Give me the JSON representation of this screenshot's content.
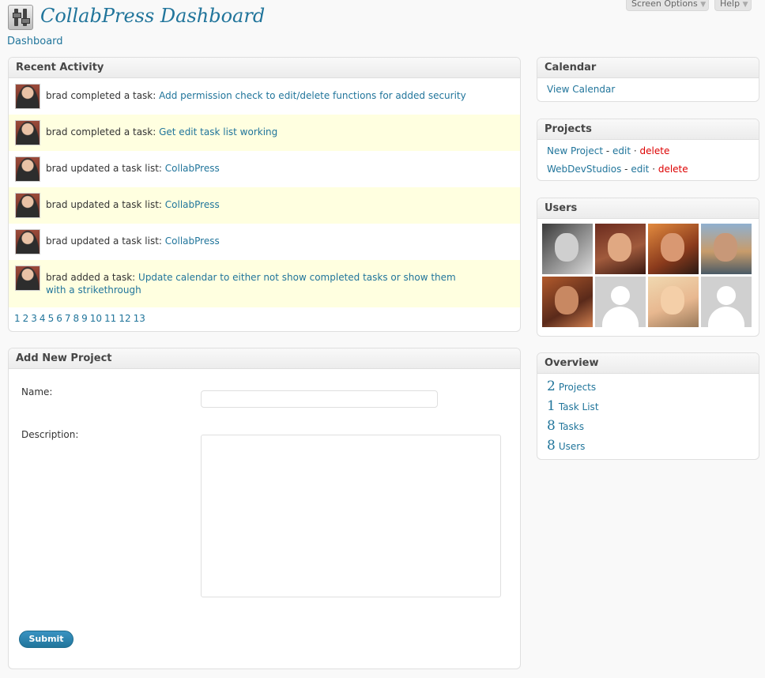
{
  "header": {
    "title": "CollabPress Dashboard",
    "breadcrumb": "Dashboard",
    "screen_options": "Screen Options",
    "help": "Help",
    "dropdown_glyph": "▼"
  },
  "recent_activity": {
    "title": "Recent Activity",
    "items": [
      {
        "text": "brad completed a task: ",
        "link": "Add permission check to edit/delete functions for added security"
      },
      {
        "text": "brad completed a task: ",
        "link": "Get edit task list working"
      },
      {
        "text": "brad updated a task list: ",
        "link": "CollabPress"
      },
      {
        "text": "brad updated a task list: ",
        "link": "CollabPress"
      },
      {
        "text": "brad updated a task list: ",
        "link": "CollabPress"
      },
      {
        "text": "brad added a task: ",
        "link": "Update calendar to either not show completed tasks or show them with a strikethrough"
      }
    ],
    "pages": [
      "1",
      "2",
      "3",
      "4",
      "5",
      "6",
      "7",
      "8",
      "9",
      "10",
      "11",
      "12",
      "13"
    ]
  },
  "add_project": {
    "title": "Add New Project",
    "name_label": "Name:",
    "name_value": "",
    "description_label": "Description:",
    "description_value": "",
    "submit_label": "Submit"
  },
  "calendar": {
    "title": "Calendar",
    "link": "View Calendar"
  },
  "projects": {
    "title": "Projects",
    "items": [
      {
        "name": "New Project",
        "edit": "edit",
        "delete": "delete"
      },
      {
        "name": "WebDevStudios",
        "edit": "edit",
        "delete": "delete"
      }
    ],
    "separator": " - ",
    "dot": " · "
  },
  "users": {
    "title": "Users",
    "avatars": [
      "photo",
      "photo",
      "photo",
      "photo",
      "photo",
      "default",
      "photo",
      "default"
    ]
  },
  "overview": {
    "title": "Overview",
    "items": [
      {
        "count": "2",
        "label": "Projects"
      },
      {
        "count": "1",
        "label": "Task List"
      },
      {
        "count": "8",
        "label": "Tasks"
      },
      {
        "count": "8",
        "label": "Users"
      }
    ]
  },
  "colors": {
    "link": "#21759b",
    "delete": "#dd0000",
    "alt_row": "#ffffe0"
  }
}
